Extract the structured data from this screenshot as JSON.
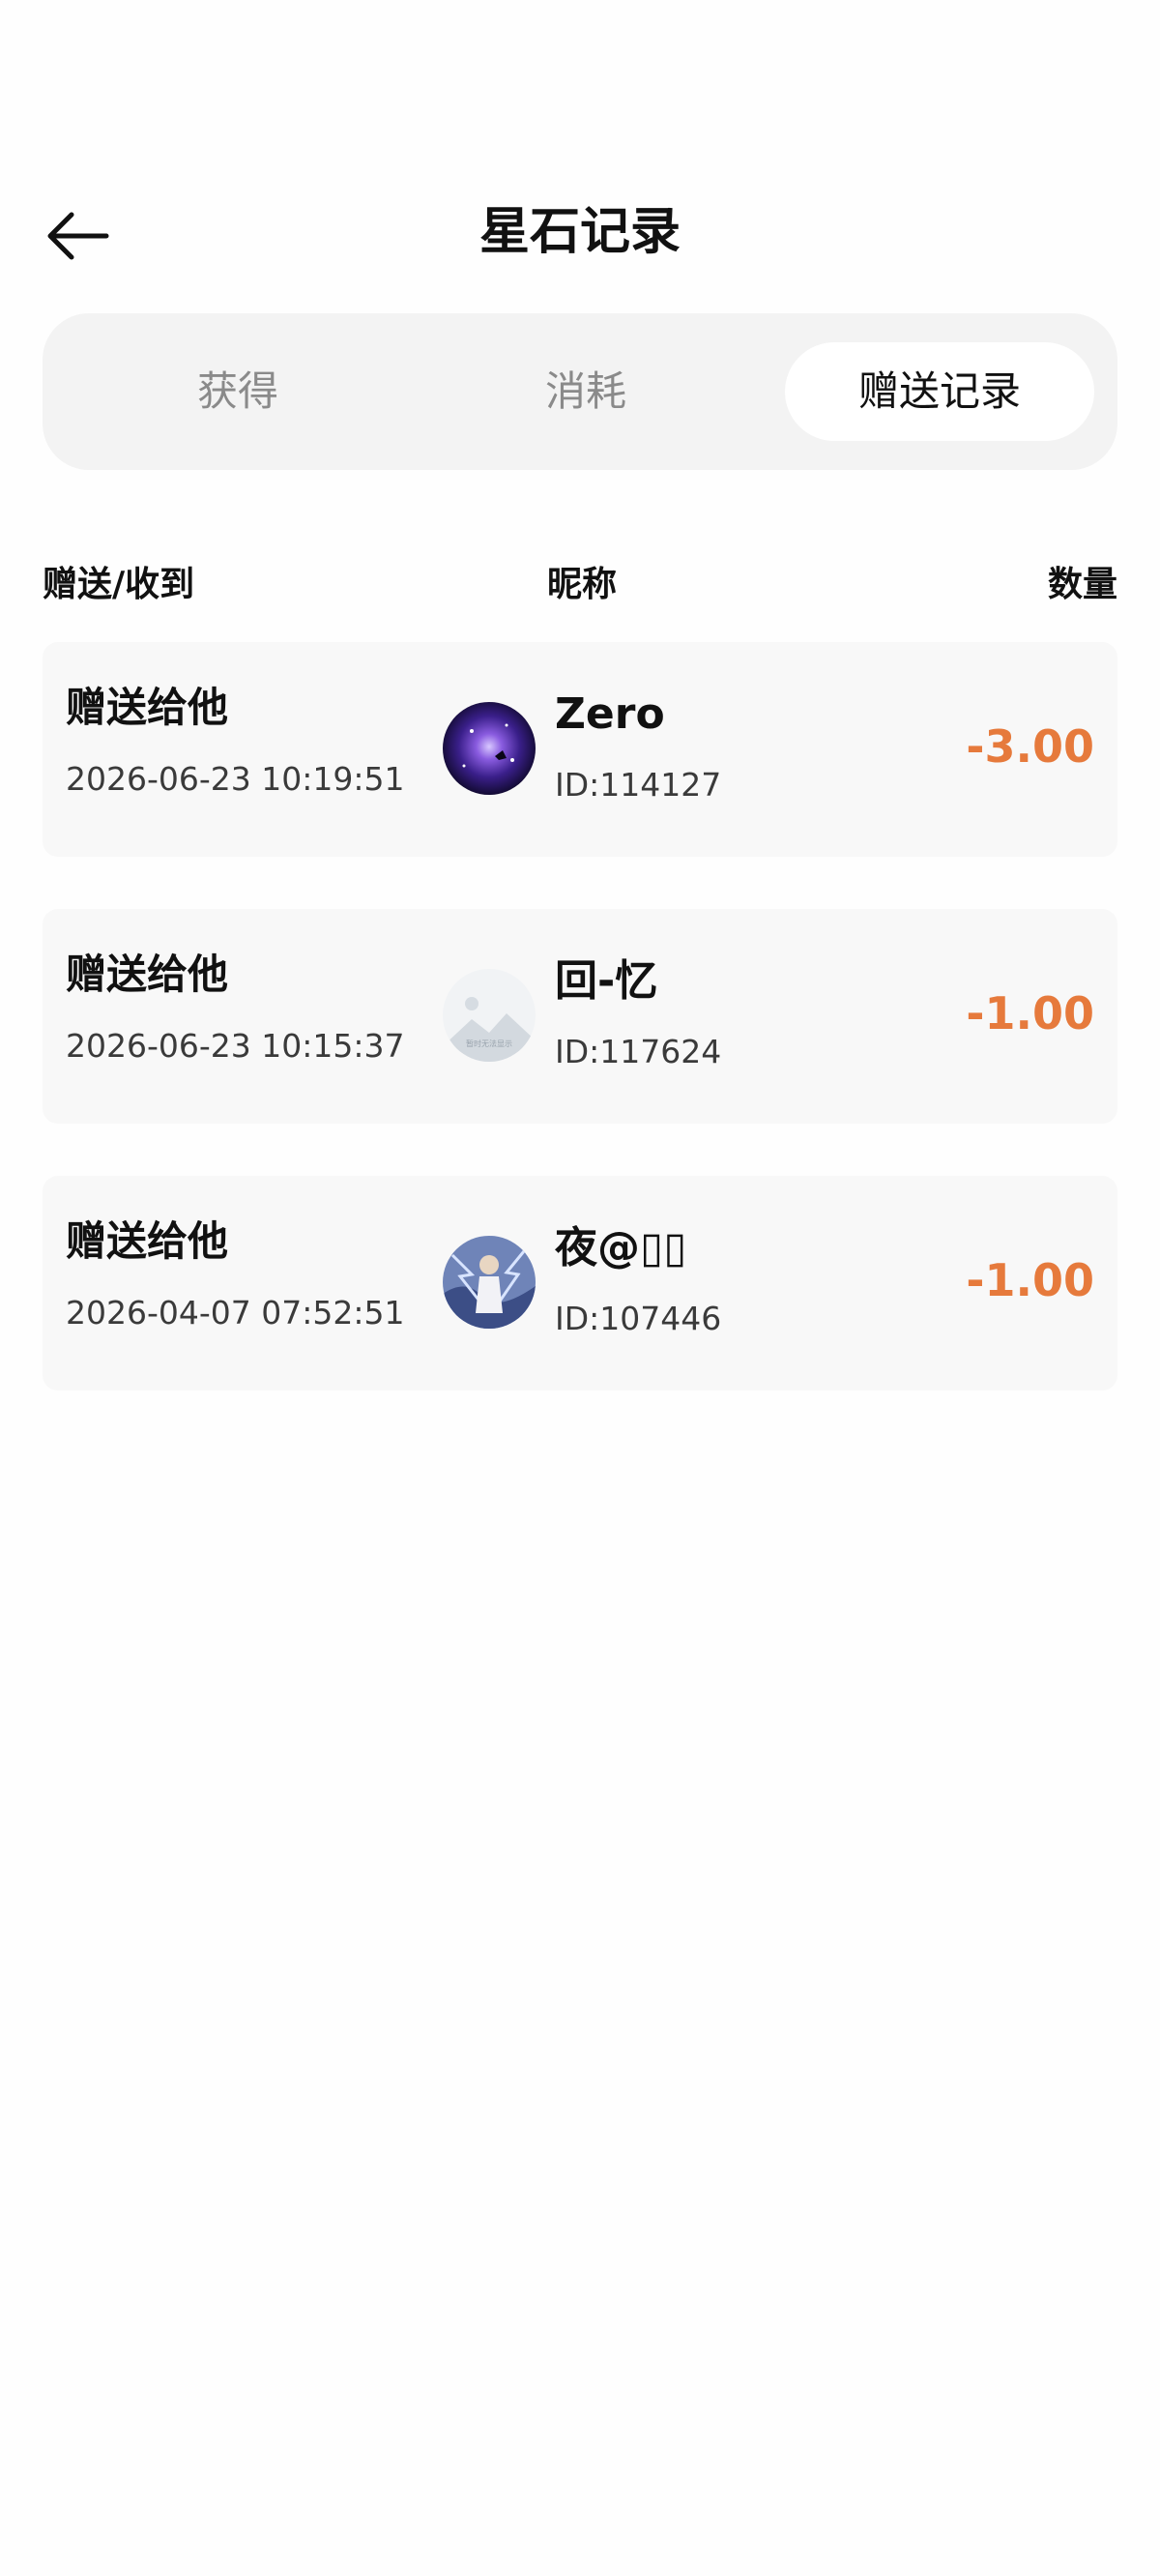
{
  "header": {
    "title": "星石记录",
    "back_icon": "arrow-left-icon"
  },
  "tabs": [
    {
      "label": "获得",
      "active": false
    },
    {
      "label": "消耗",
      "active": false
    },
    {
      "label": "赠送记录",
      "active": true
    }
  ],
  "columns": {
    "direction": "赠送/收到",
    "nickname": "昵称",
    "quantity": "数量"
  },
  "records": [
    {
      "type": "赠送给他",
      "time": "2026-06-23 10:19:51",
      "nickname": "Zero",
      "id": "ID:114127",
      "amount": "-3.00",
      "avatar": "galaxy-avatar"
    },
    {
      "type": "赠送给他",
      "time": "2026-06-23 10:15:37",
      "nickname": "回-忆",
      "id": "ID:117624",
      "amount": "-1.00",
      "avatar": "placeholder-image-avatar",
      "avatar_caption": "暂时无法显示"
    },
    {
      "type": "赠送给他",
      "time": "2026-04-07 07:52:51",
      "nickname": "夜@▯▯",
      "id": "ID:107446",
      "amount": "-1.00",
      "avatar": "character-art-avatar"
    }
  ],
  "colors": {
    "amount": "#e67a3c",
    "tab_bar_bg": "#f3f3f3",
    "card_bg": "#f8f8f8"
  }
}
